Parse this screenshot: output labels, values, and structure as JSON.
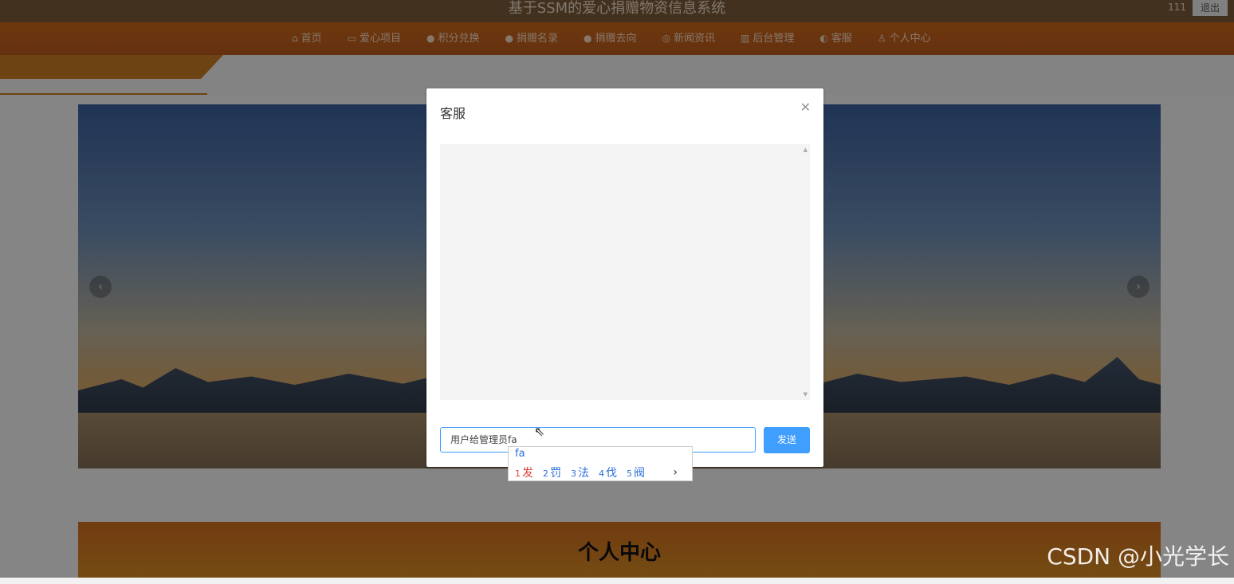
{
  "header": {
    "title": "基于SSM的爱心捐赠物资信息系统",
    "user": "111",
    "logout": "退出"
  },
  "nav": {
    "items": [
      {
        "icon": "home-icon",
        "label": "首页"
      },
      {
        "icon": "folder-icon",
        "label": "爱心项目"
      },
      {
        "icon": "info-icon",
        "label": "积分兑换"
      },
      {
        "icon": "info-icon",
        "label": "捐赠名录"
      },
      {
        "icon": "info-icon",
        "label": "捐赠去向"
      },
      {
        "icon": "globe-icon",
        "label": "新闻资讯"
      },
      {
        "icon": "building-icon",
        "label": "后台管理"
      },
      {
        "icon": "support-icon",
        "label": "客服"
      },
      {
        "icon": "user-icon",
        "label": "个人中心"
      }
    ]
  },
  "section": {
    "title": "个人中心"
  },
  "dialog": {
    "title": "客服",
    "input_value": "用户给管理员fa",
    "send_label": "发送"
  },
  "ime": {
    "composition": "fa",
    "candidates": [
      {
        "n": "1",
        "text": "发"
      },
      {
        "n": "2",
        "text": "罚"
      },
      {
        "n": "3",
        "text": "法"
      },
      {
        "n": "4",
        "text": "伐"
      },
      {
        "n": "5",
        "text": "阀"
      }
    ],
    "next": "›"
  },
  "watermark": "CSDN @小光学长"
}
